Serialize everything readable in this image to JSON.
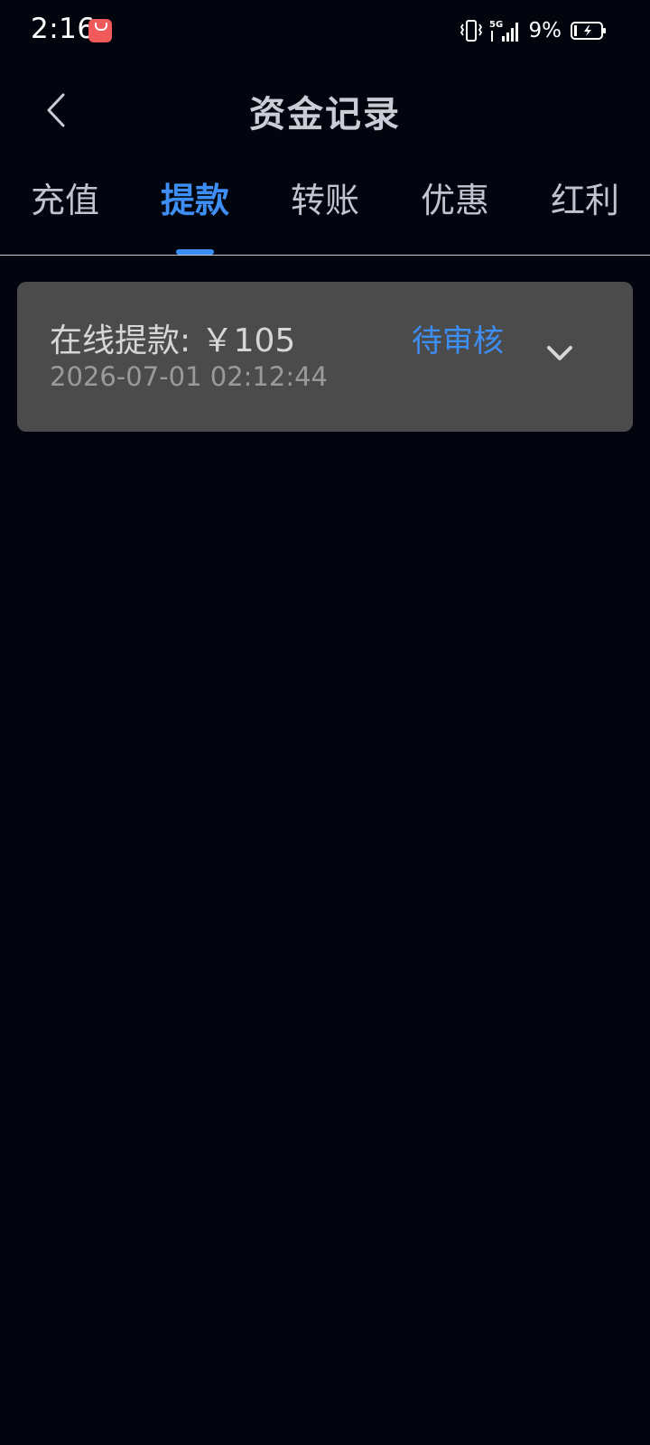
{
  "status_bar": {
    "time": "2:16",
    "battery_percent": "9%",
    "icons": [
      "app-notification-icon",
      "vibrate-icon",
      "5g-signal-icon",
      "battery-charging-icon"
    ]
  },
  "header": {
    "title": "资金记录",
    "back_icon": "chevron-left-icon"
  },
  "tabs": [
    {
      "label": "充值",
      "active": false
    },
    {
      "label": "提款",
      "active": true
    },
    {
      "label": "转账",
      "active": false
    },
    {
      "label": "优惠",
      "active": false
    },
    {
      "label": "红利",
      "active": false
    }
  ],
  "records": [
    {
      "title": "在线提款: ￥105",
      "time": "2026-07-01 02:12:44",
      "status": "待审核",
      "expand_icon": "chevron-down-icon"
    }
  ],
  "colors": {
    "background": "#03050e",
    "accent": "#3d8ff5",
    "card": "#4b4b4b"
  }
}
